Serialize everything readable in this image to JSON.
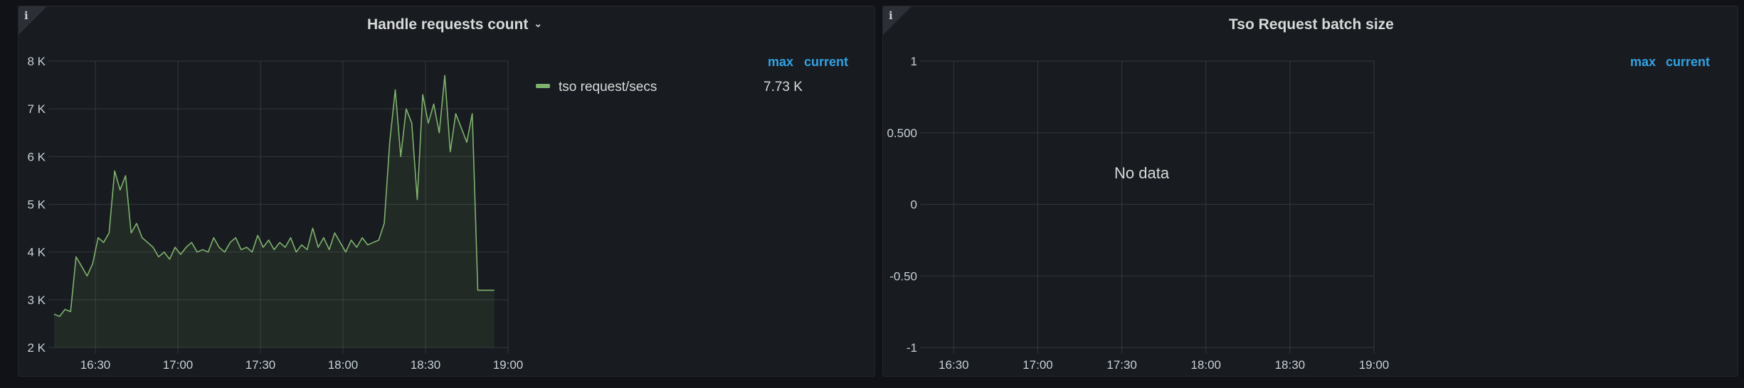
{
  "panels": {
    "left": {
      "title": "Handle requests count",
      "legend": {
        "headers": [
          "max",
          "current"
        ],
        "series_label": "tso request/secs",
        "series_value": "7.73 K"
      }
    },
    "right": {
      "title": "Tso Request batch size",
      "legend": {
        "headers": [
          "max",
          "current"
        ]
      },
      "no_data_text": "No data"
    }
  },
  "info_icon": "info-icon",
  "colors": {
    "series": "#7eb26d",
    "legend_header": "#33a2e5",
    "panel_bg": "#181b1f",
    "page_bg": "#111217"
  },
  "chart_data": [
    {
      "type": "area",
      "title": "Handle requests count",
      "xlabel": "",
      "ylabel": "",
      "x_ticks": [
        "16:30",
        "17:00",
        "17:30",
        "18:00",
        "18:30",
        "19:00"
      ],
      "y_ticks": [
        "2 K",
        "3 K",
        "4 K",
        "5 K",
        "6 K",
        "7 K",
        "8 K"
      ],
      "ylim": [
        2000,
        8000
      ],
      "xlim": [
        "16:15",
        "19:00"
      ],
      "grid": true,
      "legend_position": "right",
      "series": [
        {
          "name": "tso request/secs",
          "x": [
            "16:15",
            "16:17",
            "16:19",
            "16:21",
            "16:23",
            "16:25",
            "16:27",
            "16:29",
            "16:31",
            "16:33",
            "16:35",
            "16:37",
            "16:39",
            "16:41",
            "16:43",
            "16:45",
            "16:47",
            "16:49",
            "16:51",
            "16:53",
            "16:55",
            "16:57",
            "16:59",
            "17:01",
            "17:03",
            "17:05",
            "17:07",
            "17:09",
            "17:11",
            "17:13",
            "17:15",
            "17:17",
            "17:19",
            "17:21",
            "17:23",
            "17:25",
            "17:27",
            "17:29",
            "17:31",
            "17:33",
            "17:35",
            "17:37",
            "17:39",
            "17:41",
            "17:43",
            "17:45",
            "17:47",
            "17:49",
            "17:51",
            "17:53",
            "17:55",
            "17:57",
            "17:59",
            "18:01",
            "18:03",
            "18:05",
            "18:07",
            "18:09",
            "18:11",
            "18:13",
            "18:15",
            "18:17",
            "18:19",
            "18:21",
            "18:23",
            "18:25",
            "18:27",
            "18:29",
            "18:31",
            "18:33",
            "18:35",
            "18:37",
            "18:39",
            "18:41",
            "18:43",
            "18:45",
            "18:47",
            "18:49",
            "18:51",
            "18:53",
            "18:55"
          ],
          "values": [
            2700,
            2650,
            2800,
            2750,
            3900,
            3700,
            3500,
            3750,
            4300,
            4200,
            4400,
            5700,
            5300,
            5600,
            4400,
            4600,
            4300,
            4200,
            4100,
            3900,
            4000,
            3850,
            4100,
            3950,
            4100,
            4200,
            4000,
            4050,
            4000,
            4300,
            4100,
            4000,
            4200,
            4300,
            4050,
            4100,
            4000,
            4350,
            4100,
            4250,
            4050,
            4200,
            4100,
            4300,
            4000,
            4150,
            4050,
            4500,
            4100,
            4300,
            4050,
            4400,
            4200,
            4000,
            4250,
            4100,
            4300,
            4150,
            4200,
            4250,
            4600,
            6300,
            7400,
            6000,
            7000,
            6700,
            5100,
            7300,
            6700,
            7100,
            6500,
            7700,
            6100,
            6900,
            6600,
            6300,
            6900,
            3200,
            3200,
            3200,
            3200
          ]
        }
      ]
    },
    {
      "type": "line",
      "title": "Tso Request batch size",
      "xlabel": "",
      "ylabel": "",
      "x_ticks": [
        "16:30",
        "17:00",
        "17:30",
        "18:00",
        "18:30",
        "19:00"
      ],
      "y_ticks": [
        "1",
        "0.500",
        "0",
        "-0.50",
        "-1"
      ],
      "ylim": [
        -1,
        1
      ],
      "grid": true,
      "legend_position": "right",
      "series": []
    }
  ]
}
